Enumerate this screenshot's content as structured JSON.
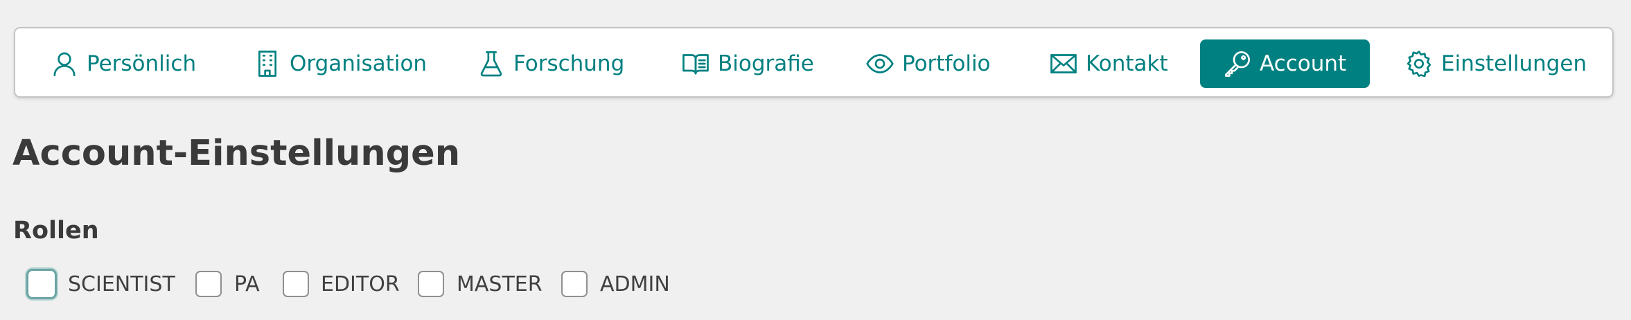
{
  "nav": {
    "items": [
      {
        "label": "Persönlich",
        "icon": "person-icon"
      },
      {
        "label": "Organisation",
        "icon": "building-icon"
      },
      {
        "label": "Forschung",
        "icon": "flask-icon"
      },
      {
        "label": "Biografie",
        "icon": "open-book-icon"
      },
      {
        "label": "Portfolio",
        "icon": "eye-icon"
      },
      {
        "label": "Kontakt",
        "icon": "envelope-icon"
      },
      {
        "label": "Account",
        "icon": "key-icon",
        "active": true
      },
      {
        "label": "Einstellungen",
        "icon": "gear-icon"
      }
    ]
  },
  "page": {
    "title": "Account-Einstellungen"
  },
  "roles": {
    "heading": "Rollen",
    "options": [
      {
        "label": "SCIENTIST",
        "checked": false,
        "focused": true
      },
      {
        "label": "PA",
        "checked": false
      },
      {
        "label": "EDITOR",
        "checked": false
      },
      {
        "label": "MASTER",
        "checked": false
      },
      {
        "label": "ADMIN",
        "checked": false
      }
    ]
  },
  "colors": {
    "accent": "#008080",
    "background": "#f0f0f0",
    "text": "#3c3c3c"
  }
}
